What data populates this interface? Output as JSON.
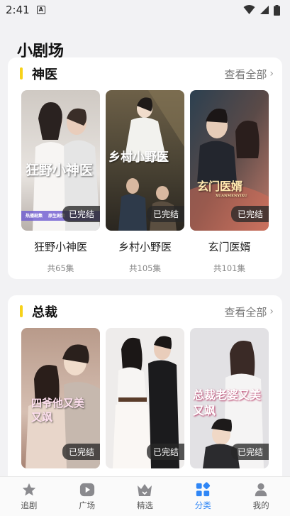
{
  "status": {
    "time": "2:41",
    "notif_icon": "A"
  },
  "page": {
    "title": "小剧场"
  },
  "sections": [
    {
      "title": "神医",
      "more": "查看全部",
      "items": [
        {
          "title": "狂野小神医",
          "episodes": "共65集",
          "badge": "已完结",
          "cover_text": "狂野小神医",
          "cover_sub1": "热播剧集",
          "cover_sub2": "原生剧集"
        },
        {
          "title": "乡村小野医",
          "episodes": "共105集",
          "badge": "已完结",
          "cover_text": "乡村小野医"
        },
        {
          "title": "玄门医婿",
          "episodes": "共101集",
          "badge": "已完结",
          "cover_text": "玄门医婿",
          "cover_sub1": "XUANMENYIXU"
        }
      ]
    },
    {
      "title": "总裁",
      "more": "查看全部",
      "items": [
        {
          "badge": "已完结",
          "cover_text": "四爷他又美又飒"
        },
        {
          "badge": "已完结"
        },
        {
          "badge": "已完结",
          "cover_text": "总裁老婆又美又飒"
        }
      ]
    }
  ],
  "tabs": [
    {
      "label": "追剧",
      "icon": "star-icon",
      "active": false
    },
    {
      "label": "广场",
      "icon": "play-icon",
      "active": false
    },
    {
      "label": "精选",
      "icon": "crown-icon",
      "active": false
    },
    {
      "label": "分类",
      "icon": "category-icon",
      "active": true
    },
    {
      "label": "我的",
      "icon": "user-icon",
      "active": false
    }
  ],
  "colors": {
    "accent": "#2f86f6",
    "section_bar": "#f7d21a"
  }
}
